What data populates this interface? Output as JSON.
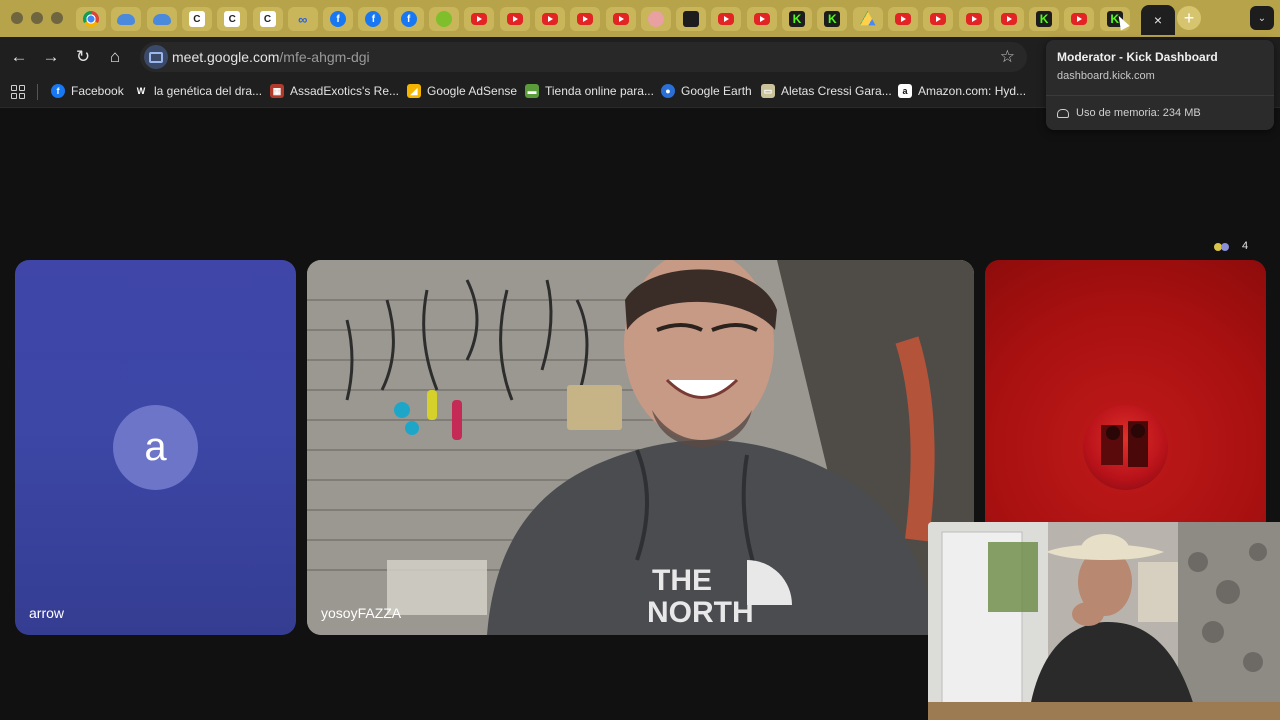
{
  "window": {
    "title": "Moderator - Kick Dashboard"
  },
  "tabs": {
    "favicons": [
      "chrome-icon",
      "cloud-icon",
      "cloud-icon",
      "c-icon",
      "c-icon",
      "c-icon",
      "meta-icon",
      "facebook-icon",
      "facebook-icon",
      "facebook-icon",
      "green-circle-icon",
      "youtube-icon",
      "youtube-icon",
      "youtube-icon",
      "youtube-icon",
      "youtube-icon",
      "pink-circle-icon",
      "bag-icon",
      "youtube-icon",
      "youtube-icon",
      "kick-icon",
      "kick-icon",
      "drive-icon",
      "youtube-icon",
      "youtube-icon",
      "youtube-icon",
      "youtube-icon",
      "kick-icon",
      "youtube-icon",
      "kick-icon"
    ],
    "active_close": "×",
    "new_tab": "+",
    "search_tabs": "⌄"
  },
  "toolbar": {
    "back": "←",
    "forward": "→",
    "reload": "↻",
    "home": "⌂",
    "url_host": "meet.google.com",
    "url_path": "/mfe-ahgm-dgi",
    "bookmark_star": "☆"
  },
  "bookmarks": [
    {
      "label": "Facebook",
      "icon": "facebook-icon",
      "color": "#1877f2",
      "glyph": "f"
    },
    {
      "label": "la genética del dra...",
      "icon": "w-icon",
      "color": "#1f1f1f",
      "glyph": "W"
    },
    {
      "label": "AssadExotics's Re...",
      "icon": "assad-icon",
      "color": "#b23a2a",
      "glyph": "▦"
    },
    {
      "label": "Google AdSense",
      "icon": "adsense-icon",
      "color": "#f5b400",
      "glyph": "◢"
    },
    {
      "label": "Tienda online para...",
      "icon": "store-icon",
      "color": "#5a9b3a",
      "glyph": "▬"
    },
    {
      "label": "Google Earth",
      "icon": "earth-icon",
      "color": "#2a6fd6",
      "glyph": "●"
    },
    {
      "label": "Aletas Cressi Gara...",
      "icon": "cressi-icon",
      "color": "#c9c29a",
      "glyph": "▭"
    },
    {
      "label": "Amazon.com: Hyd...",
      "icon": "amazon-icon",
      "color": "#ffffff",
      "glyph": "a"
    }
  ],
  "hover_card": {
    "title": "Moderator - Kick Dashboard",
    "url": "dashboard.kick.com",
    "memory": "Uso de memoria: 234 MB"
  },
  "meet": {
    "participant_count": "4",
    "tiles": [
      {
        "name": "arrow",
        "initial": "a"
      },
      {
        "name": "yosoyFAZZA"
      },
      {
        "name": ""
      }
    ]
  },
  "colors": {
    "tabstrip": "#b7a34a",
    "toolbar": "#1f1f1f",
    "stage": "#111111",
    "arrow_tile": "#3c47a6",
    "red_tile": "#a81010"
  }
}
